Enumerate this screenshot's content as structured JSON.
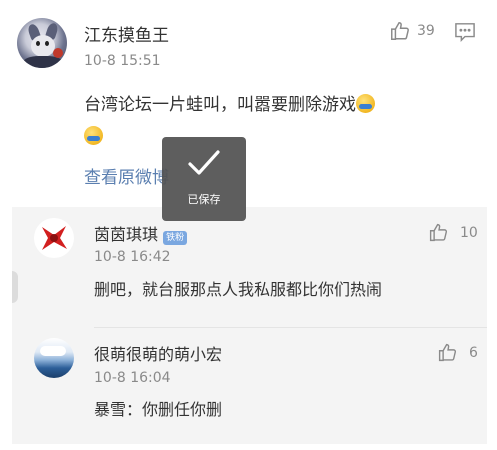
{
  "post": {
    "author": "江东摸鱼王",
    "time": "10-8 15:51",
    "likes": "39",
    "content": "台湾论坛一片蛙叫，叫嚣要删除游戏",
    "view_original": "查看原微博"
  },
  "comments": [
    {
      "author": "茵茵琪琪",
      "badge": "铁粉",
      "time": "10-8 16:42",
      "likes": "10",
      "content": "删吧，就台服那点人我私服都比你们热闹"
    },
    {
      "author": "很萌很萌的萌小宏",
      "time": "10-8 16:04",
      "likes": "6",
      "content": "暴雪：你删任你删"
    }
  ],
  "toast": {
    "label": "已保存"
  },
  "colors": {
    "link": "#5b7fb0",
    "muted": "#8a8a8a",
    "badge": "#7aa7e0"
  }
}
